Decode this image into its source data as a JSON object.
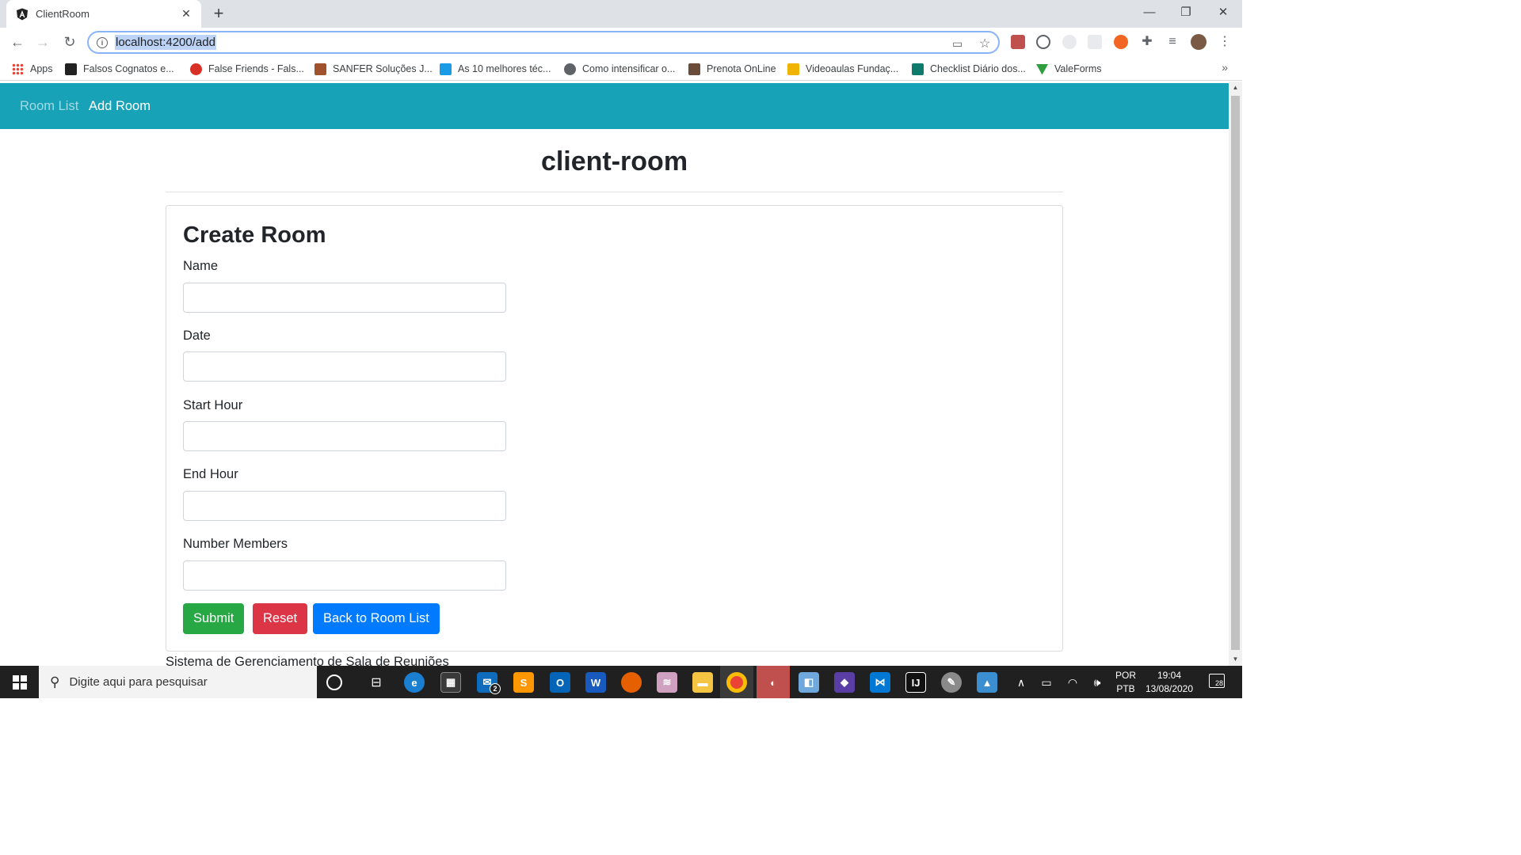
{
  "browser": {
    "tab_title": "ClientRoom",
    "tab_close": "✕",
    "new_tab": "+",
    "url": "localhost:4200/add",
    "window_controls": {
      "minimize": "—",
      "maximize": "❐",
      "close": "✕"
    },
    "bookmarks": [
      {
        "label": "Apps",
        "icon_color": "#ea4335"
      },
      {
        "label": "Falsos Cognatos e...",
        "icon_color": "#222222"
      },
      {
        "label": "False Friends - Fals...",
        "icon_color": "#d93025"
      },
      {
        "label": "SANFER Soluções J...",
        "icon_color": "#a0522d"
      },
      {
        "label": "As 10 melhores téc...",
        "icon_color": "#1a9be6"
      },
      {
        "label": "Como intensificar o...",
        "icon_color": "#5f6368"
      },
      {
        "label": "Prenota OnLine",
        "icon_color": "#6b4c3b"
      },
      {
        "label": "Videoaulas Fundaç...",
        "icon_color": "#f0b400"
      },
      {
        "label": "Checklist Diário dos...",
        "icon_color": "#0f7b6c"
      },
      {
        "label": "ValeForms",
        "icon_color": "#2e9e3e"
      }
    ],
    "bookmarks_more": "»"
  },
  "app": {
    "nav": {
      "room_list": "Room List",
      "add_room": "Add Room"
    },
    "title": "client-room",
    "form": {
      "heading": "Create Room",
      "fields": [
        {
          "label": "Name",
          "value": ""
        },
        {
          "label": "Date",
          "value": ""
        },
        {
          "label": "Start Hour",
          "value": ""
        },
        {
          "label": "End Hour",
          "value": ""
        },
        {
          "label": "Number Members",
          "value": ""
        }
      ],
      "buttons": {
        "submit": "Submit",
        "reset": "Reset",
        "back": "Back to Room List"
      }
    },
    "footer": "Sistema de Gerenciamento de Sala de Reuniões",
    "colors": {
      "navbar": "#17a2b8",
      "success": "#28a745",
      "danger": "#dc3545",
      "primary": "#007bff"
    }
  },
  "taskbar": {
    "search_placeholder": "Digite aqui para pesquisar",
    "mail_badge": "2",
    "language_line1": "POR",
    "language_line2": "PTB",
    "time": "19:04",
    "date": "13/08/2020",
    "notification_count": "28"
  }
}
